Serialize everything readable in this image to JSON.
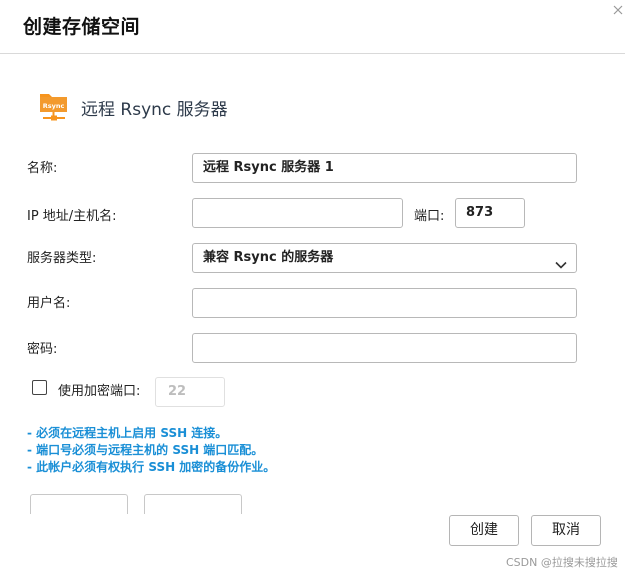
{
  "dialog": {
    "title": "创建存储空间",
    "close_icon": "close-icon"
  },
  "service": {
    "icon": "rsync-server-icon",
    "icon_text": "Rsync",
    "icon_color": "#f7941d",
    "title": "远程 Rsync 服务器"
  },
  "form": {
    "name_label": "名称:",
    "name_value": "远程 Rsync 服务器 1",
    "host_label": "IP 地址/主机名:",
    "host_value": "",
    "port_label": "端口:",
    "port_value": "873",
    "server_type_label": "服务器类型:",
    "server_type_value": "兼容 Rsync 的服务器",
    "username_label": "用户名:",
    "username_value": "",
    "password_label": "密码:",
    "password_value": "",
    "encrypted_port_label": "使用加密端口:",
    "encrypted_port_checked": false,
    "encrypted_port_value": "22"
  },
  "notes": [
    "- 必须在远程主机上启用 SSH 连接。",
    "- 端口号必须与远程主机的 SSH 端口匹配。",
    "- 此帐户必须有权执行 SSH 加密的备份作业。"
  ],
  "colors": {
    "note_text": "#1a8fd6",
    "service_title": "#2d3a4a"
  },
  "buttons": {
    "create": "创建",
    "cancel": "取消"
  },
  "watermark": "CSDN @拉搜未搜拉搜"
}
